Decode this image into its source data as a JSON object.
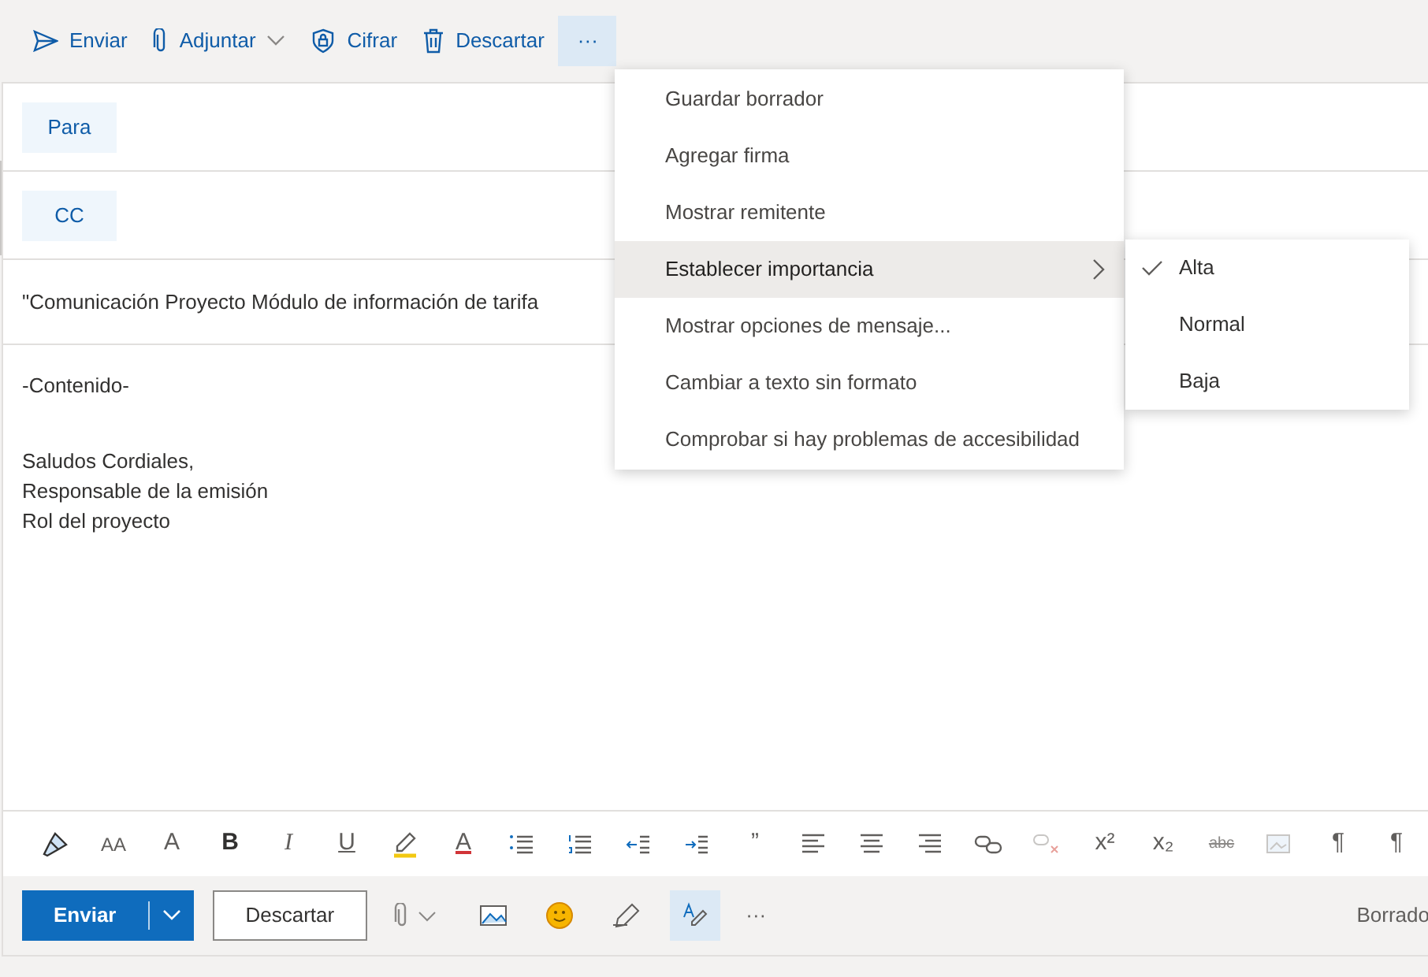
{
  "command_bar": [
    {
      "label": "Enviar",
      "kind": "send"
    },
    {
      "label": "Adjuntar",
      "kind": "attach"
    },
    {
      "label": "Cifrar",
      "kind": "encrypt"
    },
    {
      "label": "Descartar",
      "kind": "discard"
    },
    {
      "label": "···",
      "kind": "more",
      "selected": true
    }
  ],
  "recipients": [
    {
      "label": "Para"
    },
    {
      "label": "CC"
    }
  ],
  "subject": "\"Comunicación Proyecto Módulo de información de tarifa",
  "body": [
    "-Contenido-",
    "Saludos Cordiales,",
    "Responsable de la emisión",
    "Rol del proyecto"
  ],
  "more_menu": [
    {
      "label": "Guardar borrador",
      "selected": false,
      "submenu": false
    },
    {
      "label": "Agregar firma",
      "selected": false,
      "submenu": false
    },
    {
      "label": "Mostrar remitente",
      "selected": false,
      "submenu": false
    },
    {
      "label": "Establecer importancia",
      "selected": true,
      "submenu": true
    },
    {
      "label": "Mostrar opciones de mensaje...",
      "selected": false,
      "submenu": false
    },
    {
      "label": "Cambiar a texto sin formato",
      "selected": false,
      "submenu": false
    },
    {
      "label": "Comprobar si hay problemas de accesibilidad",
      "selected": false,
      "submenu": false
    }
  ],
  "importance_menu": [
    {
      "label": "Alta",
      "checked": true
    },
    {
      "label": "Normal",
      "checked": false
    },
    {
      "label": "Baja",
      "checked": false
    }
  ],
  "format_toolbar": [
    {
      "kind": "icon"
    },
    {
      "kind": "glyph",
      "glyph": "AA"
    },
    {
      "kind": "glyph",
      "glyph": "A"
    },
    {
      "kind": "glyph",
      "glyph": "B"
    },
    {
      "kind": "glyph",
      "glyph": "I"
    },
    {
      "kind": "glyph",
      "glyph": "U"
    },
    {
      "kind": "icon"
    },
    {
      "kind": "glyph",
      "glyph": "A"
    },
    {
      "kind": "icon"
    },
    {
      "kind": "icon"
    },
    {
      "kind": "icon"
    },
    {
      "kind": "icon"
    },
    {
      "kind": "glyph",
      "glyph": "”"
    },
    {
      "kind": "icon"
    },
    {
      "kind": "icon"
    },
    {
      "kind": "icon"
    },
    {
      "kind": "icon"
    },
    {
      "kind": "icon"
    },
    {
      "kind": "glyph",
      "glyph": "x²"
    },
    {
      "kind": "glyph",
      "glyph": "x₂"
    },
    {
      "kind": "glyph",
      "glyph": "abc"
    },
    {
      "kind": "icon"
    },
    {
      "kind": "glyph",
      "glyph": "¶"
    },
    {
      "kind": "glyph",
      "glyph": "¶"
    }
  ],
  "actions": {
    "send": "Enviar",
    "discard": "Descartar",
    "more": "···",
    "editor_active": true,
    "status": "Borrado"
  }
}
